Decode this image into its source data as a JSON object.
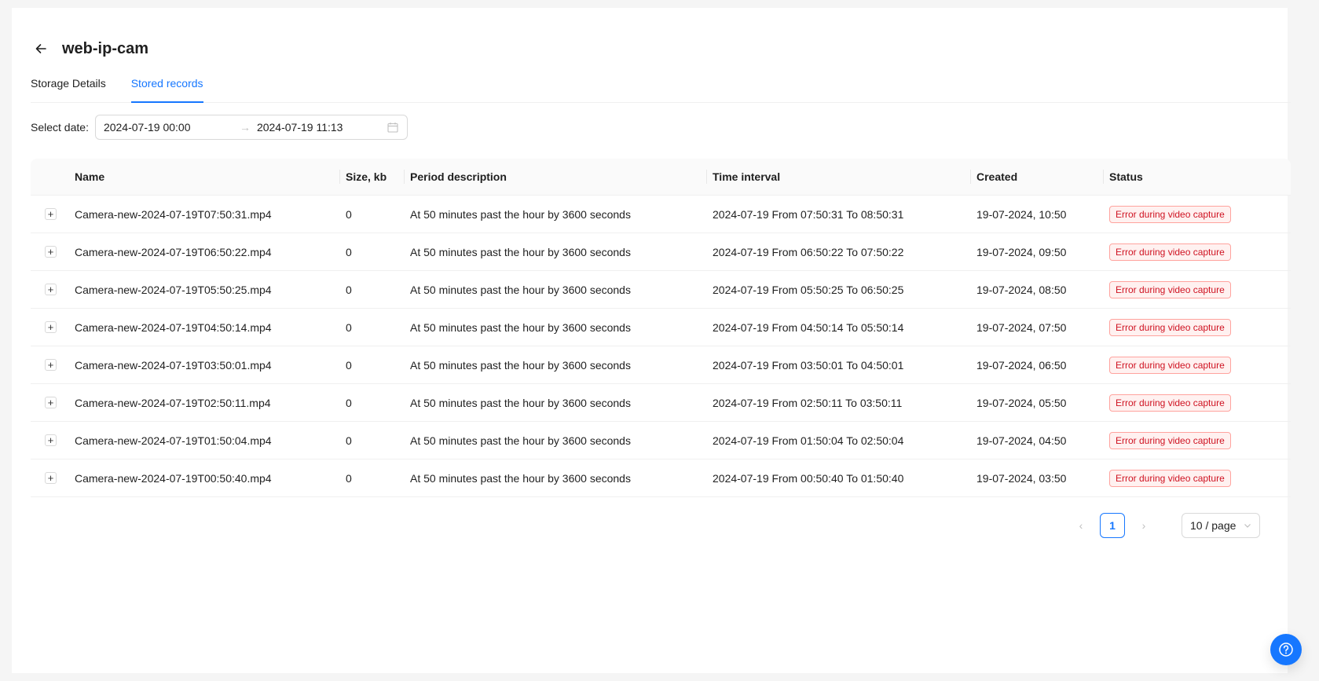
{
  "header": {
    "title": "web-ip-cam",
    "back_icon": "arrow-left-icon"
  },
  "tabs": [
    {
      "label": "Storage Details",
      "active": false
    },
    {
      "label": "Stored records",
      "active": true
    }
  ],
  "filter": {
    "label": "Select date",
    "start": "2024-07-19 00:00",
    "separator": "→",
    "end": "2024-07-19 11:13"
  },
  "table": {
    "columns": [
      "Name",
      "Size, kb",
      "Period description",
      "Time interval",
      "Created",
      "Status"
    ],
    "rows": [
      {
        "name": "Camera-new-2024-07-19T07:50:31.mp4",
        "size": "0",
        "period": "At 50 minutes past the hour by 3600 seconds",
        "interval": "2024-07-19 From 07:50:31 To 08:50:31",
        "created": "19-07-2024, 10:50",
        "status": "Error during video capture"
      },
      {
        "name": "Camera-new-2024-07-19T06:50:22.mp4",
        "size": "0",
        "period": "At 50 minutes past the hour by 3600 seconds",
        "interval": "2024-07-19 From 06:50:22 To 07:50:22",
        "created": "19-07-2024, 09:50",
        "status": "Error during video capture"
      },
      {
        "name": "Camera-new-2024-07-19T05:50:25.mp4",
        "size": "0",
        "period": "At 50 minutes past the hour by 3600 seconds",
        "interval": "2024-07-19 From 05:50:25 To 06:50:25",
        "created": "19-07-2024, 08:50",
        "status": "Error during video capture"
      },
      {
        "name": "Camera-new-2024-07-19T04:50:14.mp4",
        "size": "0",
        "period": "At 50 minutes past the hour by 3600 seconds",
        "interval": "2024-07-19 From 04:50:14 To 05:50:14",
        "created": "19-07-2024, 07:50",
        "status": "Error during video capture"
      },
      {
        "name": "Camera-new-2024-07-19T03:50:01.mp4",
        "size": "0",
        "period": "At 50 minutes past the hour by 3600 seconds",
        "interval": "2024-07-19 From 03:50:01 To 04:50:01",
        "created": "19-07-2024, 06:50",
        "status": "Error during video capture"
      },
      {
        "name": "Camera-new-2024-07-19T02:50:11.mp4",
        "size": "0",
        "period": "At 50 minutes past the hour by 3600 seconds",
        "interval": "2024-07-19 From 02:50:11 To 03:50:11",
        "created": "19-07-2024, 05:50",
        "status": "Error during video capture"
      },
      {
        "name": "Camera-new-2024-07-19T01:50:04.mp4",
        "size": "0",
        "period": "At 50 minutes past the hour by 3600 seconds",
        "interval": "2024-07-19 From 01:50:04 To 02:50:04",
        "created": "19-07-2024, 04:50",
        "status": "Error during video capture"
      },
      {
        "name": "Camera-new-2024-07-19T00:50:40.mp4",
        "size": "0",
        "period": "At 50 minutes past the hour by 3600 seconds",
        "interval": "2024-07-19 From 00:50:40 To 01:50:40",
        "created": "19-07-2024, 03:50",
        "status": "Error during video capture"
      }
    ],
    "expand_symbol": "+"
  },
  "pagination": {
    "prev": "‹",
    "current": "1",
    "next": "›",
    "page_size": "10 / page"
  },
  "colors": {
    "accent": "#1677ff",
    "error": "#cf1322",
    "error_bg": "#fff1f0",
    "error_border": "#ffa39e"
  },
  "help": {
    "icon": "question-circle-icon"
  }
}
